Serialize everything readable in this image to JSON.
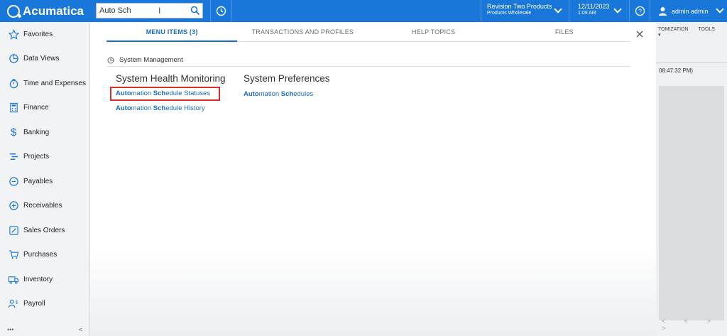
{
  "app": {
    "name": "Acumatica"
  },
  "search": {
    "value": "Auto Sch"
  },
  "branch": {
    "line1": "Revision Two Products",
    "line2": "Products Wholesale"
  },
  "datetime": {
    "date": "12/11/2023",
    "time": "1:09 AM"
  },
  "user": {
    "name": "admin admin"
  },
  "sidebar": {
    "items": [
      {
        "label": "Favorites",
        "icon": "star-icon"
      },
      {
        "label": "Data Views",
        "icon": "pie-chart-icon"
      },
      {
        "label": "Time and Expenses",
        "icon": "stopwatch-icon"
      },
      {
        "label": "Finance",
        "icon": "calculator-icon"
      },
      {
        "label": "Banking",
        "icon": "dollar-icon"
      },
      {
        "label": "Projects",
        "icon": "projects-icon"
      },
      {
        "label": "Payables",
        "icon": "minus-circle-icon"
      },
      {
        "label": "Receivables",
        "icon": "plus-circle-icon"
      },
      {
        "label": "Sales Orders",
        "icon": "edit-icon"
      },
      {
        "label": "Purchases",
        "icon": "cart-icon"
      },
      {
        "label": "Inventory",
        "icon": "truck-icon"
      },
      {
        "label": "Payroll",
        "icon": "payroll-icon"
      }
    ],
    "more": "•••",
    "collapse": "<"
  },
  "background": {
    "tabs": [
      "TOMIZATION",
      "TOOLS ▾"
    ],
    "time": "08:47:32 PM)",
    "pager": "< < > >"
  },
  "popup": {
    "tabs": [
      {
        "label": "MENU ITEMS  (3)",
        "active": true
      },
      {
        "label": "TRANSACTIONS AND PROFILES",
        "active": false
      },
      {
        "label": "HELP TOPICS",
        "active": false
      },
      {
        "label": "FILES",
        "active": false
      }
    ],
    "section": "System Management",
    "columns": [
      {
        "title": "System Health Monitoring",
        "links": [
          {
            "parts": [
              "Auto",
              "mation ",
              "Sch",
              "edule Statuses"
            ],
            "highlighted": true
          },
          {
            "parts": [
              "Auto",
              "mation ",
              "Sch",
              "edule History"
            ],
            "highlighted": false
          }
        ]
      },
      {
        "title": "System Preferences",
        "links": [
          {
            "parts": [
              "Auto",
              "mation ",
              "Sch",
              "edules"
            ],
            "highlighted": false
          }
        ]
      }
    ]
  },
  "colors": {
    "topbar": "#1877d8",
    "link": "#1a6cc4",
    "highlight": "#d9302b"
  }
}
